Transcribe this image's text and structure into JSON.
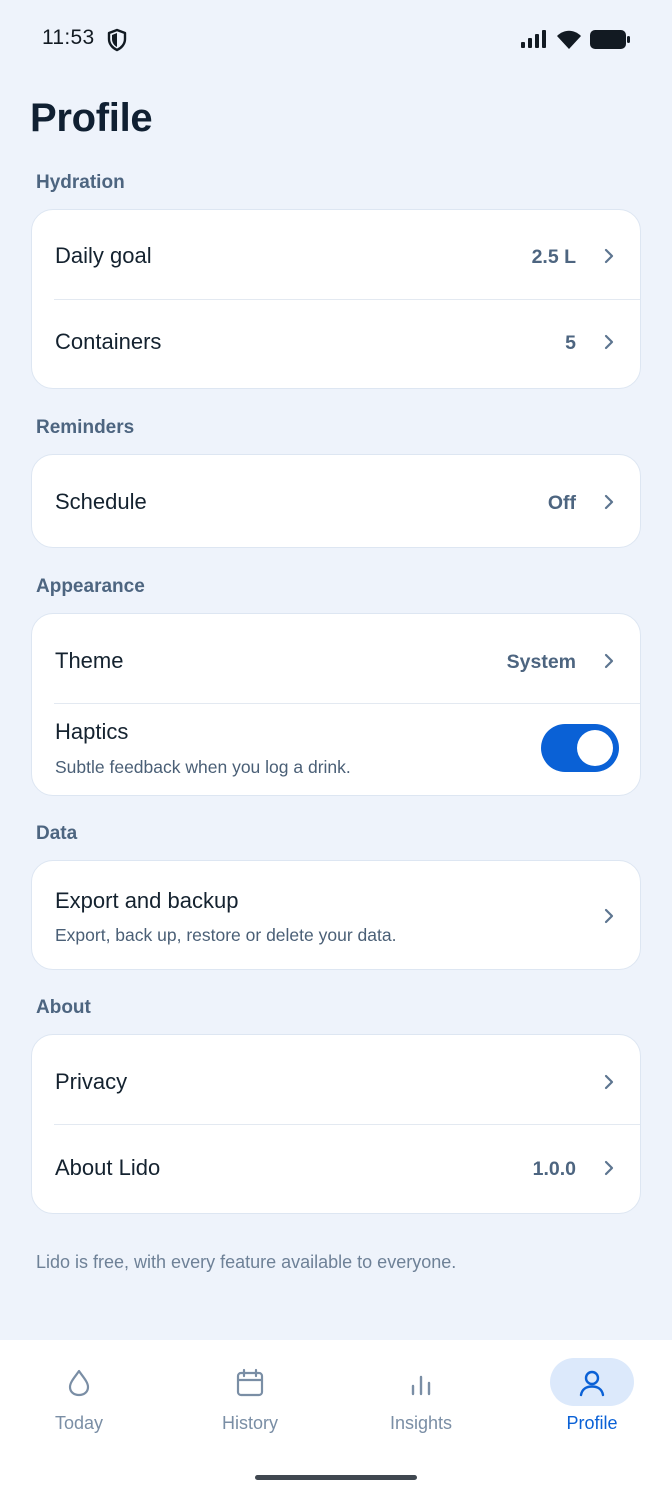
{
  "status_bar": {
    "time": "11:53",
    "icons": [
      "shield-icon",
      "signal-icon",
      "wifi-icon",
      "battery-icon"
    ]
  },
  "page": {
    "title": "Profile"
  },
  "sections": {
    "hydration": {
      "label": "Hydration",
      "rows": [
        {
          "label": "Daily goal",
          "value": "2.5 L"
        },
        {
          "label": "Containers",
          "value": "5"
        }
      ]
    },
    "reminders": {
      "label": "Reminders",
      "rows": [
        {
          "label": "Schedule",
          "value": "Off"
        }
      ]
    },
    "appearance": {
      "label": "Appearance",
      "rows": [
        {
          "label": "Theme",
          "value": "System"
        },
        {
          "label": "Haptics",
          "subtitle": "Subtle feedback when you log a drink.",
          "toggle_on": true
        }
      ]
    },
    "data": {
      "label": "Data",
      "rows": [
        {
          "label": "Export and backup",
          "subtitle": "Export, back up, restore or delete your data."
        }
      ]
    },
    "about": {
      "label": "About",
      "rows": [
        {
          "label": "Privacy",
          "value": ""
        },
        {
          "label": "About Lido",
          "value": "1.0.0"
        }
      ]
    }
  },
  "footer_note": "Lido is free, with every feature available to everyone.",
  "bottom_nav": {
    "items": [
      {
        "label": "Today",
        "icon": "drop-icon",
        "active": false
      },
      {
        "label": "History",
        "icon": "calendar-icon",
        "active": false
      },
      {
        "label": "Insights",
        "icon": "bar-chart-icon",
        "active": false
      },
      {
        "label": "Profile",
        "icon": "person-icon",
        "active": true
      }
    ]
  },
  "colors": {
    "background": "#eef3fb",
    "card": "#ffffff",
    "accent": "#0a61d6",
    "section_label": "#4d6580",
    "active_pill": "#dce9fb"
  }
}
